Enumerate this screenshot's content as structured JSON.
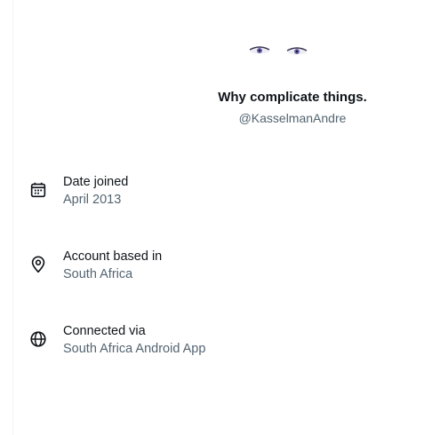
{
  "profile": {
    "name": "Why complicate things.",
    "handle": "@KasselmanAndre"
  },
  "about_rows": [
    {
      "icon": "calendar-icon",
      "label": "Date joined",
      "value": "April 2013"
    },
    {
      "icon": "location-pin-icon",
      "label": "Account based in",
      "value": "South Africa"
    },
    {
      "icon": "globe-icon",
      "label": "Connected via",
      "value": "South Africa Android App"
    }
  ],
  "colors": {
    "primary_text": "#0f1419",
    "secondary_text": "#536471",
    "divider": "#eff3f4"
  }
}
